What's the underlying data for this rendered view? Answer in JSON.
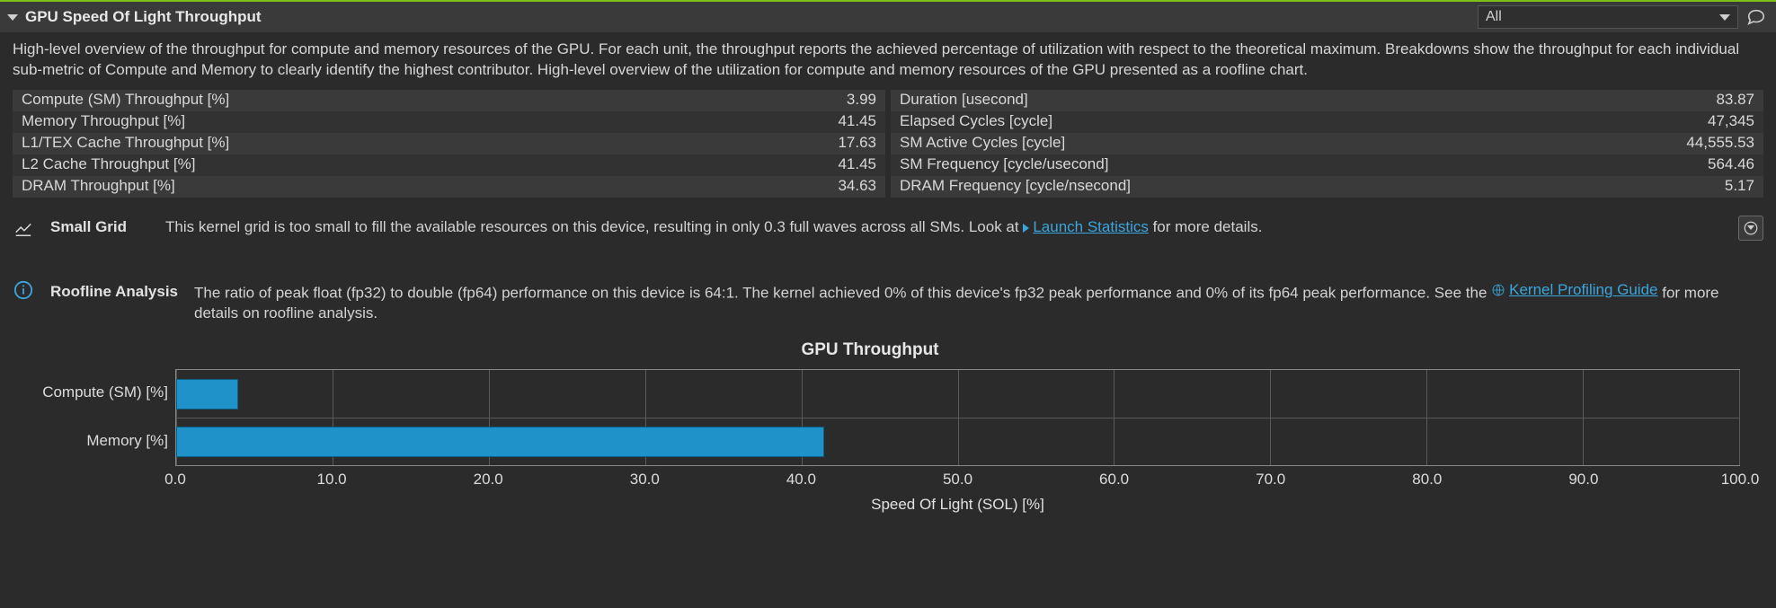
{
  "header": {
    "title": "GPU Speed Of Light Throughput",
    "dropdown_value": "All"
  },
  "description": "High-level overview of the throughput for compute and memory resources of the GPU. For each unit, the throughput reports the achieved percentage of utilization with respect to the theoretical maximum. Breakdowns show the throughput for each individual sub-metric of Compute and Memory to clearly identify the highest contributor. High-level overview of the utilization for compute and memory resources of the GPU presented as a roofline chart.",
  "metrics_left": [
    {
      "label": "Compute (SM) Throughput [%]",
      "value": "3.99"
    },
    {
      "label": "Memory Throughput [%]",
      "value": "41.45"
    },
    {
      "label": "L1/TEX Cache Throughput [%]",
      "value": "17.63"
    },
    {
      "label": "L2 Cache Throughput [%]",
      "value": "41.45"
    },
    {
      "label": "DRAM Throughput [%]",
      "value": "34.63"
    }
  ],
  "metrics_right": [
    {
      "label": "Duration [usecond]",
      "value": "83.87"
    },
    {
      "label": "Elapsed Cycles [cycle]",
      "value": "47,345"
    },
    {
      "label": "SM Active Cycles [cycle]",
      "value": "44,555.53"
    },
    {
      "label": "SM Frequency [cycle/usecond]",
      "value": "564.46"
    },
    {
      "label": "DRAM Frequency [cycle/nsecond]",
      "value": "5.17"
    }
  ],
  "small_grid": {
    "title": "Small Grid",
    "body_pre": "This kernel grid is too small to fill the available resources on this device, resulting in only 0.3 full waves across all SMs. Look at ",
    "link": "Launch Statistics",
    "body_post": " for more details."
  },
  "roofline": {
    "title": "Roofline Analysis",
    "body_pre": "The ratio of peak float (fp32) to double (fp64) performance on this device is 64:1. The kernel achieved 0% of this device's fp32 peak performance and 0% of its fp64 peak performance. See the ",
    "link": "Kernel Profiling Guide",
    "body_post": " for more details on roofline analysis."
  },
  "chart_data": {
    "type": "bar",
    "title": "GPU Throughput",
    "categories": [
      "Compute (SM) [%]",
      "Memory [%]"
    ],
    "values": [
      3.99,
      41.45
    ],
    "xlabel": "Speed Of Light (SOL) [%]",
    "ylabel": "",
    "xlim": [
      0,
      100
    ],
    "xticks": [
      0.0,
      10.0,
      20.0,
      30.0,
      40.0,
      50.0,
      60.0,
      70.0,
      80.0,
      90.0,
      100.0
    ],
    "xtick_labels": [
      "0.0",
      "10.0",
      "20.0",
      "30.0",
      "40.0",
      "50.0",
      "60.0",
      "70.0",
      "80.0",
      "90.0",
      "100.0"
    ]
  }
}
